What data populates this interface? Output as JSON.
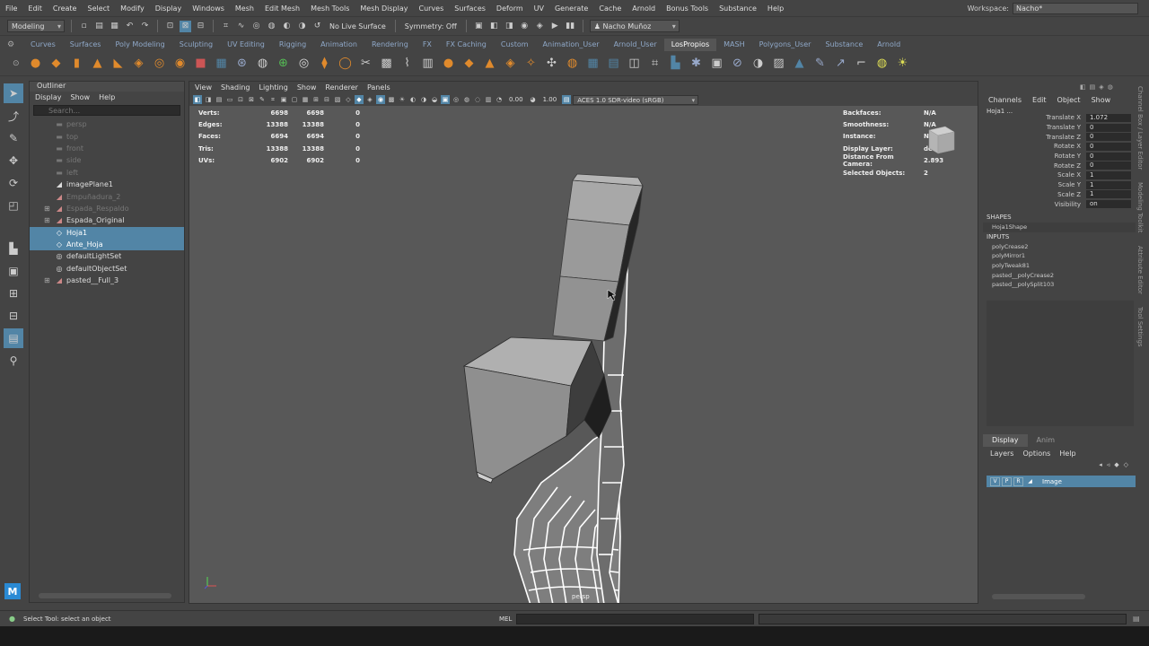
{
  "menubar": {
    "items": [
      "File",
      "Edit",
      "Create",
      "Select",
      "Modify",
      "Display",
      "Windows",
      "Mesh",
      "Edit Mesh",
      "Mesh Tools",
      "Mesh Display",
      "Curves",
      "Surfaces",
      "Deform",
      "UV",
      "Generate",
      "Cache",
      "Arnold",
      "Bonus Tools",
      "Substance",
      "Help"
    ],
    "workspace_label": "Workspace:",
    "workspace_value": "Nacho*"
  },
  "statusline": {
    "mode": "Modeling",
    "live_surface": "No Live Surface",
    "symmetry": "Symmetry: Off",
    "user": "Nacho Muñoz"
  },
  "shelf": {
    "tabs": [
      "Curves",
      "Surfaces",
      "Poly Modeling",
      "Sculpting",
      "UV Editing",
      "Rigging",
      "Animation",
      "Rendering",
      "FX",
      "FX Caching",
      "Custom",
      "Animation_User",
      "Arnold_User",
      "LosPropios",
      "MASH",
      "Polygons_User",
      "Substance",
      "Arnold"
    ],
    "active_tab": "LosPropios"
  },
  "outliner": {
    "title": "Outliner",
    "menus": [
      "Display",
      "Show",
      "Help"
    ],
    "search_placeholder": "Search...",
    "rows": [
      {
        "label": "persp",
        "dim": true,
        "sel": false,
        "exp": ""
      },
      {
        "label": "top",
        "dim": true,
        "sel": false,
        "exp": ""
      },
      {
        "label": "front",
        "dim": true,
        "sel": false,
        "exp": ""
      },
      {
        "label": "side",
        "dim": true,
        "sel": false,
        "exp": ""
      },
      {
        "label": "left",
        "dim": true,
        "sel": false,
        "exp": ""
      },
      {
        "label": "imagePlane1",
        "dim": false,
        "sel": false,
        "exp": ""
      },
      {
        "label": "Empuñadura_2",
        "dim": true,
        "sel": false,
        "exp": ""
      },
      {
        "label": "Espada_Respaldo",
        "dim": true,
        "sel": false,
        "exp": "⊞"
      },
      {
        "label": "Espada_Original",
        "dim": false,
        "sel": false,
        "exp": "⊞"
      },
      {
        "label": "Hoja1",
        "dim": false,
        "sel": true,
        "exp": ""
      },
      {
        "label": "Ante_Hoja",
        "dim": false,
        "sel": true,
        "exp": ""
      },
      {
        "label": "defaultLightSet",
        "dim": false,
        "sel": false,
        "exp": ""
      },
      {
        "label": "defaultObjectSet",
        "dim": false,
        "sel": false,
        "exp": ""
      },
      {
        "label": "pasted__Full_3",
        "dim": false,
        "sel": false,
        "exp": "⊞"
      }
    ]
  },
  "viewport": {
    "menus": [
      "View",
      "Shading",
      "Lighting",
      "Show",
      "Renderer",
      "Panels"
    ],
    "exposure": "0.00",
    "gamma": "1.00",
    "color_space": "ACES 1.0 SDR-video (sRGB)",
    "hud_left": [
      {
        "label": "Verts:",
        "v1": "6698",
        "v2": "6698",
        "v3": "0"
      },
      {
        "label": "Edges:",
        "v1": "13388",
        "v2": "13388",
        "v3": "0"
      },
      {
        "label": "Faces:",
        "v1": "6694",
        "v2": "6694",
        "v3": "0"
      },
      {
        "label": "Tris:",
        "v1": "13388",
        "v2": "13388",
        "v3": "0"
      },
      {
        "label": "UVs:",
        "v1": "6902",
        "v2": "6902",
        "v3": "0"
      }
    ],
    "hud_right": [
      {
        "label": "Backfaces:",
        "val": "N/A"
      },
      {
        "label": "Smoothness:",
        "val": "N/A"
      },
      {
        "label": "Instance:",
        "val": "No"
      },
      {
        "label": "Display Layer:",
        "val": "default"
      },
      {
        "label": "Distance From Camera:",
        "val": "2.893"
      },
      {
        "label": "Selected Objects:",
        "val": "2"
      }
    ],
    "camera_label": "persp"
  },
  "channelbox": {
    "menus": [
      "Channels",
      "Edit",
      "Object",
      "Show"
    ],
    "object_name": "Hoja1 ...",
    "channels": [
      {
        "label": "Translate X",
        "val": "1.072"
      },
      {
        "label": "Translate Y",
        "val": "0"
      },
      {
        "label": "Translate Z",
        "val": "0"
      },
      {
        "label": "Rotate X",
        "val": "0"
      },
      {
        "label": "Rotate Y",
        "val": "0"
      },
      {
        "label": "Rotate Z",
        "val": "0"
      },
      {
        "label": "Scale X",
        "val": "1"
      },
      {
        "label": "Scale Y",
        "val": "1"
      },
      {
        "label": "Scale Z",
        "val": "1"
      },
      {
        "label": "Visibility",
        "val": "on"
      }
    ],
    "shapes_header": "SHAPES",
    "shape": "Hoja1Shape",
    "inputs_header": "INPUTS",
    "inputs": [
      "polyCrease2",
      "polyMirror1",
      "polyTweak81",
      "pasted__polyCrease2",
      "pasted__polySplit103"
    ]
  },
  "sidetabs": [
    "Channel Box / Layer Editor",
    "Modeling Toolkit",
    "Attribute Editor",
    "Tool Settings"
  ],
  "layereditor": {
    "tabs": [
      "Display",
      "Anim"
    ],
    "menus": [
      "Layers",
      "Options",
      "Help"
    ],
    "layer": {
      "v": "V",
      "p": "P",
      "r": "R",
      "name": "Image"
    }
  },
  "cmdline": {
    "help_text": "Select Tool: select an object",
    "mel_label": "MEL"
  },
  "colors": {
    "accent": "#5285a6",
    "shelf_orange": "#e08a2c"
  }
}
